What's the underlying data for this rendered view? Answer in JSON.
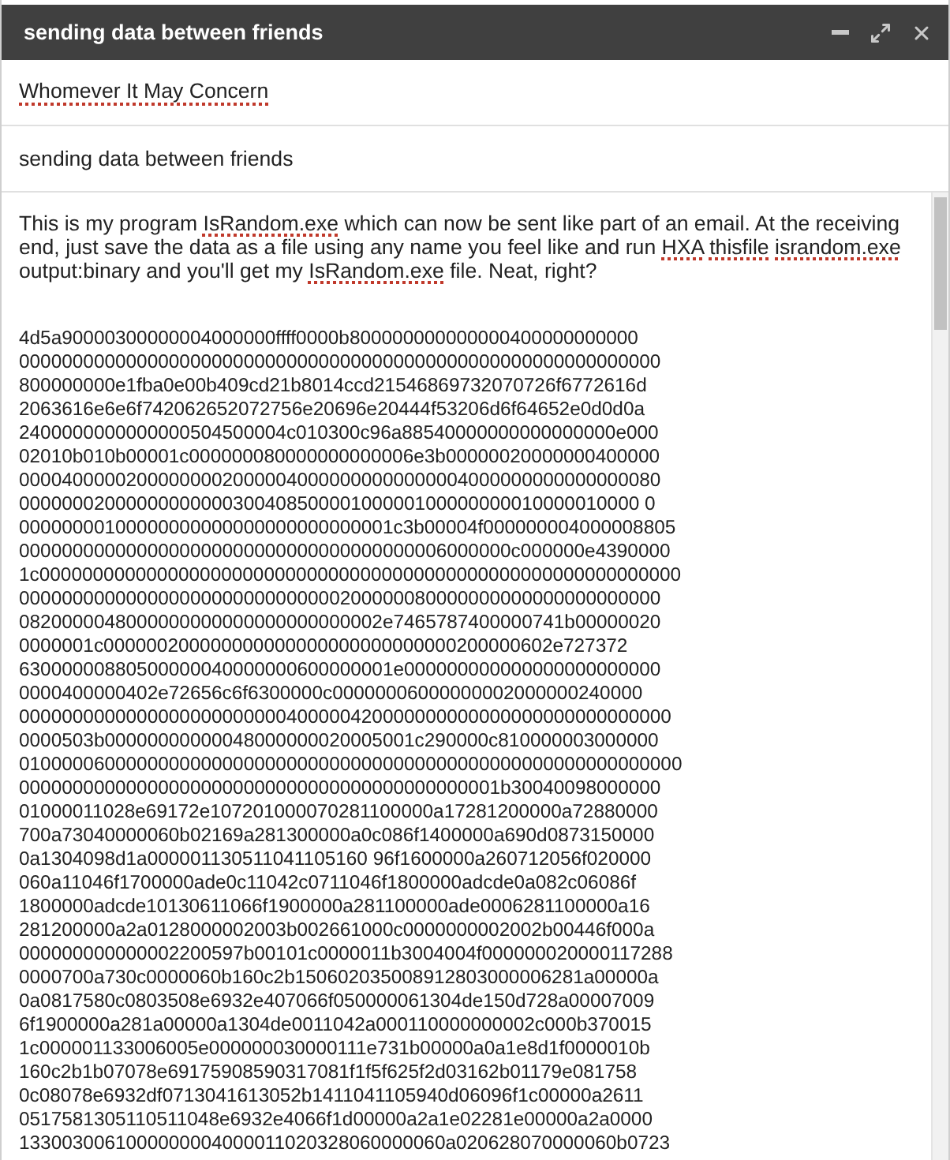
{
  "window": {
    "title": "sending data between friends",
    "controls": [
      {
        "kind": "minimize"
      },
      {
        "kind": "expand"
      },
      {
        "kind": "close"
      }
    ]
  },
  "to_field": {
    "value": "Whomever It May Concern",
    "misspelled": true
  },
  "subject_field": {
    "value": "sending data between friends"
  },
  "body": {
    "intro": [
      {
        "text": "This is my program ",
        "misspelled": false
      },
      {
        "text": "IsRandom.exe",
        "misspelled": true
      },
      {
        "text": " which can now be sent like part of an email. At the receiving end, just save the data as a file using any name you feel like and run ",
        "misspelled": false
      },
      {
        "text": "HXA",
        "misspelled": true,
        "space_after": true
      },
      {
        "text": "thisfile",
        "misspelled": true,
        "space_after": true
      },
      {
        "text": "israndom.exe",
        "misspelled": true
      },
      {
        "text": " output:binary and you'll get my ",
        "misspelled": false
      },
      {
        "text": "IsRandom.exe",
        "misspelled": true
      },
      {
        "text": " file. Neat, right?",
        "misspelled": false
      }
    ],
    "hex_lines": [
      "4d5a90000300000004000000ffff0000b800000000000000400000000000",
      "000000000000000000000000000000000000000000000000000000000000",
      "800000000e1fba0e00b409cd21b8014ccd21546869732070726f6772616d",
      "2063616e6e6f742062652072756e20696e20444f53206d6f64652e0d0d0a",
      "2400000000000000504500004c010300c96a88540000000000000000e000",
      "02010b010b00001c000000080000000000006e3b00000020000000400000",
      "000040000020000000020000040000000000000004000000000000000080",
      "0000000200000000000030040850000100000100000000010000010000 0",
      "00000000100000000000000000000000001c3b00004f000000004000008805",
      "0000000000000000000000000000000000000006000000c000000e4390000",
      "1c000000000000000000000000000000000000000000000000000000000000",
      "000000000000000000000000000000200000080000000000000000000000",
      "0820000048000000000000000000000002e7465787400000741b00000020",
      "0000001c000000200000000000000000000000000200000602e727372",
      "63000000880500000040000000600000001e000000000000000000000000",
      "0000400000402e72656c6f6300000c00000006000000002000000240000",
      "0000000000000000000000000400000420000000000000000000000000000",
      "0000503b00000000000048000000020005001c290000c810000003000000",
      "01000006000000000000000000000000000000000000000000000000000000",
      "000000000000000000000000000000000000000000001b30040098000000",
      "01000011028e69172e107201000070281100000a17281200000a72880000",
      "700a73040000060b02169a281300000a0c086f1400000a690d0873150000",
      "0a1304098d1a000001130511041105160 96f1600000a260712056f020000",
      "060a11046f1700000ade0c11042c0711046f1800000adcde0a082c06086f",
      "1800000adcde10130611066f1900000a281100000ade0006281100000a16",
      "281200000a2a0128000002003b002661000c0000000002002b00446f000a",
      "000000000000002200597b00101c0000011b3004004f000000020000117288",
      "0000700a730c0000060b160c2b150602035008912803000006281a00000a",
      "0a0817580c0803508e6932e407066f050000061304de150d728a00007009",
      "6f1900000a281a00000a1304de0011042a000110000000002c000b370015",
      "1c000001133006005e000000030000111e731b00000a0a1e8d1f0000010b",
      "160c2b1b07078e69175908590317081f1f5f625f2d03162b01179e081758",
      "0c08078e6932df0713041613052b1411041105940d06096f1c00000a2611",
      "0517581305110511048e6932e4066f1d00000a2a1e02281e00000a2a0000",
      "1330030061000000004000011020328060000060a020628070000060b0723"
    ]
  }
}
